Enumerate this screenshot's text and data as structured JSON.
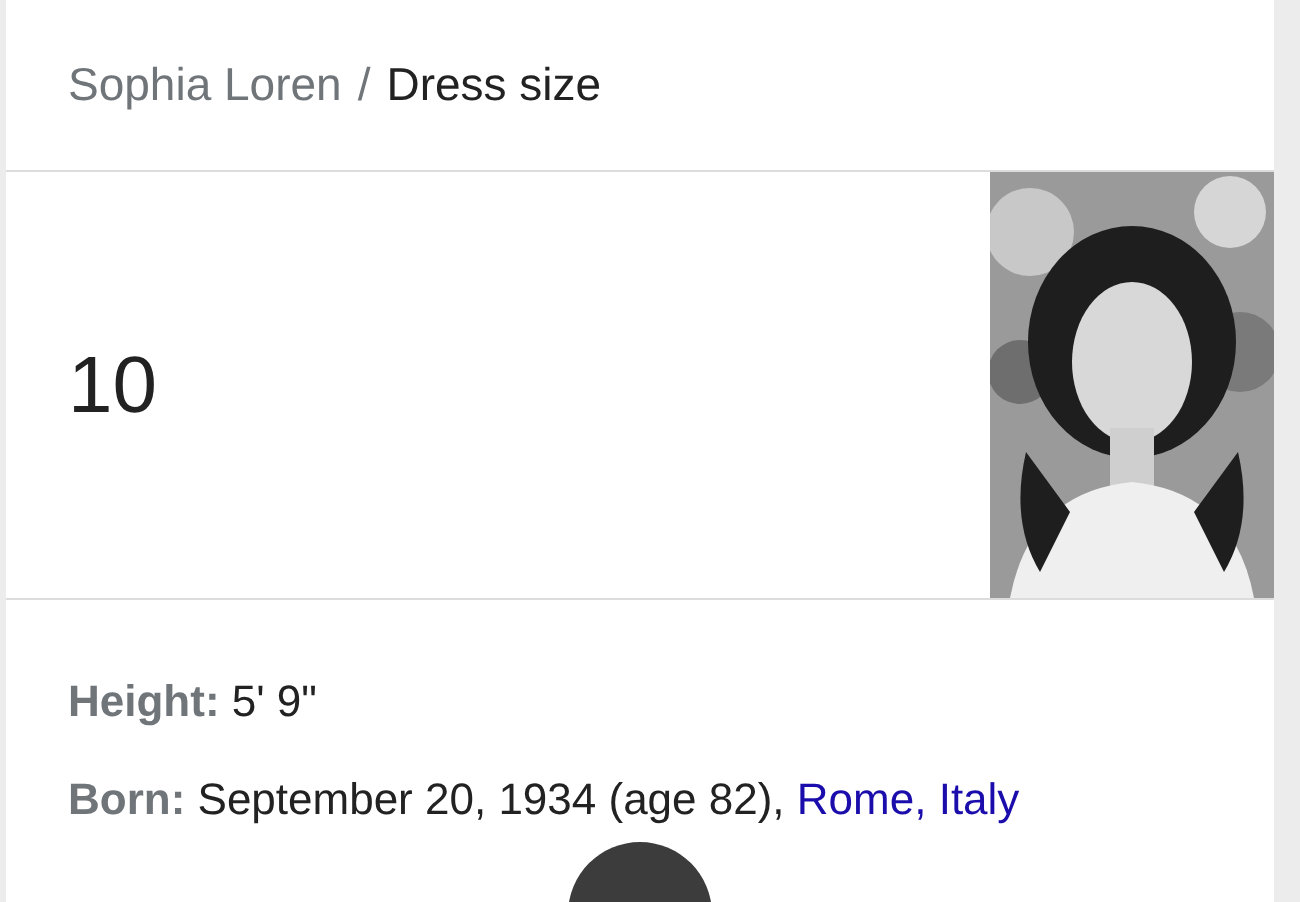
{
  "breadcrumb": {
    "parent": "Sophia Loren",
    "separator": "/",
    "current": "Dress size"
  },
  "answer": "10",
  "facts": [
    {
      "label": "Height:",
      "value": "5' 9\""
    },
    {
      "label": "Born:",
      "value": "September 20, 1934 (age 82), ",
      "link": "Rome, Italy"
    }
  ]
}
